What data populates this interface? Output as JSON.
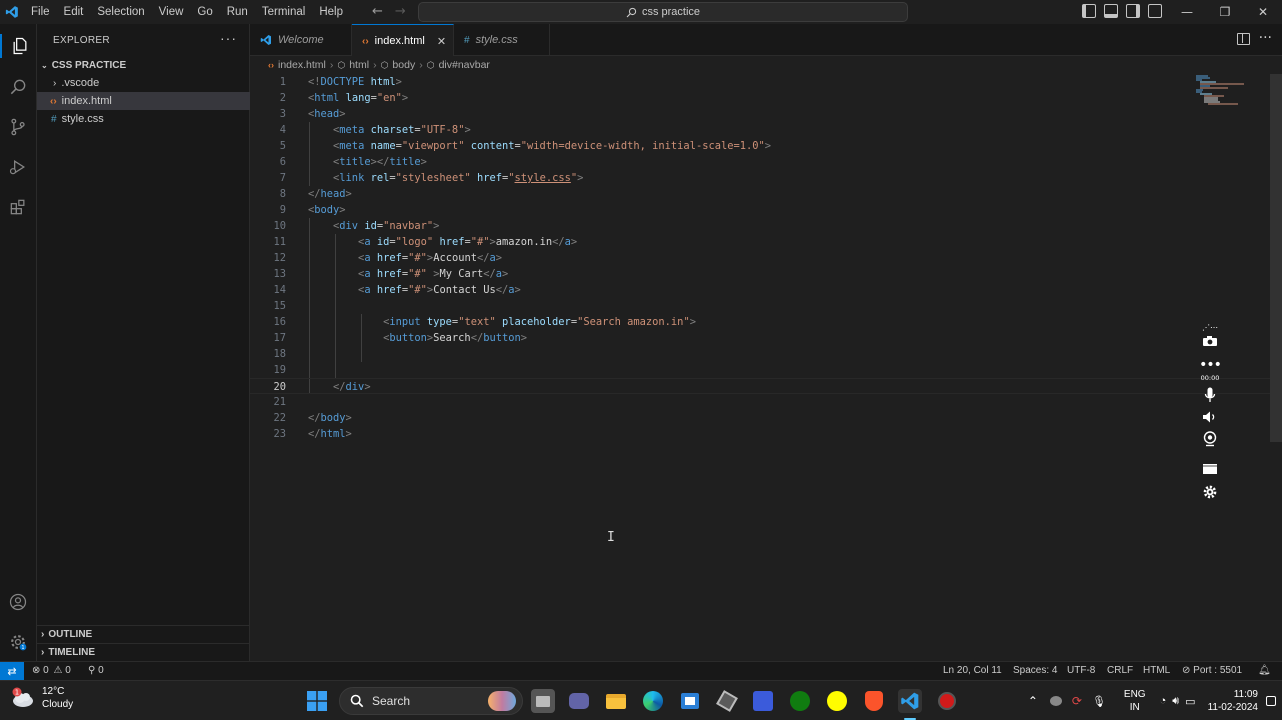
{
  "titlebar": {
    "menu": [
      "File",
      "Edit",
      "Selection",
      "View",
      "Go",
      "Run",
      "Terminal",
      "Help"
    ],
    "command_center": "css practice",
    "back_label": "←",
    "forward_label": "→",
    "minimize": "—",
    "maximize": "❐",
    "close": "✕"
  },
  "sidebar": {
    "header": "EXPLORER",
    "more": "···",
    "folder": "CSS PRACTICE",
    "files": [
      {
        "name": ".vscode",
        "type": "folder"
      },
      {
        "name": "index.html",
        "type": "html"
      },
      {
        "name": "style.css",
        "type": "css"
      }
    ],
    "outline": "OUTLINE",
    "timeline": "TIMELINE"
  },
  "tabs": [
    {
      "label": "Welcome"
    },
    {
      "label": "index.html"
    },
    {
      "label": "style.css"
    }
  ],
  "breadcrumb": [
    "index.html",
    "html",
    "body",
    "div#navbar"
  ],
  "editor": {
    "line_numbers": [
      "1",
      "2",
      "3",
      "4",
      "5",
      "6",
      "7",
      "8",
      "9",
      "10",
      "11",
      "12",
      "13",
      "14",
      "15",
      "16",
      "17",
      "18",
      "19",
      "20",
      "21",
      "22",
      "23"
    ],
    "current_line": 20
  },
  "recorder": {
    "timer": "00:00"
  },
  "statusbar": {
    "errors": "0",
    "warnings": "0",
    "ports_count": "0",
    "position": "Ln 20, Col 11",
    "spaces": "Spaces: 4",
    "encoding": "UTF-8",
    "eol": "CRLF",
    "language": "HTML",
    "port": "Port : 5501"
  },
  "taskbar": {
    "weather_temp": "12°C",
    "weather_desc": "Cloudy",
    "weather_badge": "1",
    "search_label": "Search",
    "lang_top": "ENG",
    "lang_bottom": "IN",
    "time": "11:09",
    "date": "11-02-2024"
  },
  "colors": {
    "accent": "#0078d4",
    "html_icon": "#e37933",
    "css_icon": "#519aba",
    "tag": "#569cd6",
    "attribute": "#9cdcfe",
    "string": "#ce9178"
  }
}
